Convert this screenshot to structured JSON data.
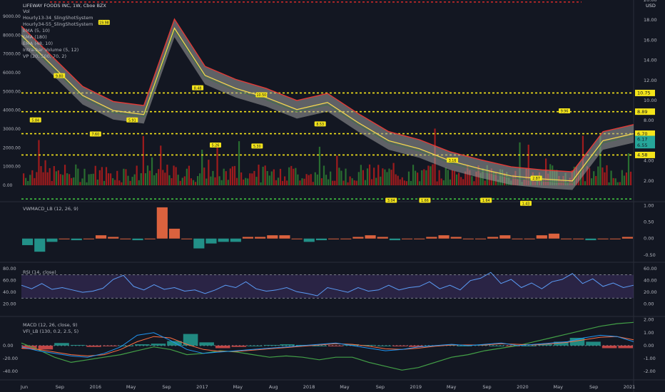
{
  "chart_data": {
    "type": "line",
    "title": "LIFEWAY FOODS INC, 1W, Cboe BZX",
    "currency": "USD",
    "indicators": [
      "Vol",
      "Hourly13-34_SlingShotSystem",
      "Hourly34-55_SlingShotSystem",
      "EMA (5, 10)",
      "SMA (180)",
      "EMA (48, 10)",
      "Intra-bar Volume (5, 12)",
      "VP (20, 500, 70, 2)"
    ],
    "x_ticks": [
      "Jun",
      "Sep",
      "2016",
      "May",
      "Sep",
      "2017",
      "May",
      "Aug",
      "2018",
      "May",
      "Sep",
      "2019",
      "May",
      "Sep",
      "2020",
      "May",
      "Sep",
      "2021"
    ],
    "main": {
      "price_axis": [
        "20.00",
        "18.00",
        "16.00",
        "14.00",
        "12.00",
        "10.00",
        "8.00",
        "6.00",
        "4.00",
        "2.00"
      ],
      "volume_axis": [
        "9000.00",
        "8000.00",
        "7000.00",
        "6000.00",
        "5000.00",
        "4000.00",
        "3000.00",
        "2000.00",
        "1000.00",
        "0.00"
      ],
      "ylim": [
        0,
        20
      ],
      "price_labels": [
        "10.75",
        "8.89",
        "6.70",
        "6.17",
        "6.55",
        "4.58"
      ],
      "levels": [
        {
          "value": 10.75,
          "color": "#f5e51a"
        },
        {
          "value": 8.89,
          "color": "#f5e51a"
        },
        {
          "value": 6.7,
          "color": "#f5e51a"
        },
        {
          "value": 4.58,
          "color": "#f5e51a"
        },
        {
          "value": 0.2,
          "color": "#3fbf3f"
        },
        {
          "value": 19.8,
          "color": "#c62828"
        }
      ],
      "price": {
        "x": [
          0,
          5,
          10,
          15,
          20,
          25,
          30,
          35,
          40,
          45,
          50,
          55,
          60,
          65,
          70,
          75,
          80,
          85,
          90,
          95,
          100
        ],
        "y": [
          16.5,
          13.5,
          10.5,
          9.0,
          8.6,
          17.2,
          12.5,
          11.2,
          10.3,
          9.1,
          9.8,
          7.8,
          6.0,
          5.2,
          4.0,
          3.2,
          2.5,
          2.2,
          2.0,
          6.0,
          6.7
        ]
      },
      "pivot_labels": [
        {
          "x": 13.5,
          "y": 17.7,
          "text": "19.98"
        },
        {
          "x": 6.2,
          "y": 12.4,
          "text": "9.80"
        },
        {
          "x": 28.8,
          "y": 11.2,
          "text": "8.48"
        },
        {
          "x": 39.2,
          "y": 10.5,
          "text": "10.50"
        },
        {
          "x": 48.8,
          "y": 7.6,
          "text": "8.53"
        },
        {
          "x": 70.4,
          "y": 4.0,
          "text": "3.16"
        },
        {
          "x": 88.7,
          "y": 8.9,
          "text": "9.96"
        },
        {
          "x": 2.3,
          "y": 8.0,
          "text": "5.84"
        },
        {
          "x": 18.1,
          "y": 8.0,
          "text": "5.91"
        },
        {
          "x": 12.1,
          "y": 6.6,
          "text": "7.60"
        },
        {
          "x": 31.7,
          "y": 5.5,
          "text": "5.26"
        },
        {
          "x": 38.5,
          "y": 5.4,
          "text": "5.30"
        },
        {
          "x": 60.4,
          "y": 0.0,
          "text": "3.04"
        },
        {
          "x": 65.9,
          "y": 0.0,
          "text": "1.66"
        },
        {
          "x": 75.9,
          "y": 0.0,
          "text": "1.64"
        },
        {
          "x": 82.4,
          "y": -0.3,
          "text": "1.43"
        },
        {
          "x": 84.1,
          "y": 2.2,
          "text": "2.87"
        }
      ]
    },
    "vwmacd": {
      "title": "VWMACD_LB (12, 26, 9)",
      "axis": [
        "1.00",
        "0.50",
        "0.00",
        "-0.50"
      ],
      "ylim": [
        -0.7,
        1.1
      ],
      "values": [
        -0.2,
        -0.4,
        -0.1,
        0.0,
        -0.05,
        0.0,
        0.1,
        0.05,
        0.0,
        -0.05,
        0.0,
        0.95,
        0.3,
        0.0,
        -0.3,
        -0.15,
        -0.1,
        -0.1,
        0.05,
        0.05,
        0.1,
        0.1,
        0.0,
        -0.1,
        -0.05,
        0.0,
        0.0,
        0.05,
        0.1,
        0.05,
        -0.05,
        0.0,
        0.0,
        0.05,
        0.1,
        0.05,
        0.0,
        0.0,
        0.05,
        0.1,
        0.0,
        0.0,
        0.1,
        0.15,
        0.0,
        0.0,
        -0.05,
        0.0,
        0.0,
        0.05
      ]
    },
    "rsi": {
      "title": "RSI (14, close)",
      "axis_left": [
        "80.00",
        "60.00",
        "40.00",
        "20.00"
      ],
      "axis_right": [
        "60.00",
        "40.00",
        "20.00",
        "0.00"
      ],
      "ylim": [
        0,
        90
      ],
      "band": [
        70,
        30
      ],
      "values": [
        52,
        46,
        55,
        45,
        48,
        44,
        40,
        42,
        47,
        62,
        69,
        50,
        44,
        53,
        45,
        48,
        42,
        44,
        38,
        44,
        52,
        48,
        58,
        46,
        42,
        44,
        48,
        41,
        38,
        34,
        48,
        44,
        40,
        48,
        42,
        44,
        52,
        44,
        48,
        50,
        58,
        46,
        52,
        44,
        60,
        64,
        74,
        55,
        62,
        48,
        56,
        46,
        58,
        62,
        72,
        55,
        63,
        50,
        56,
        48,
        52
      ]
    },
    "macd": {
      "title": "MACD (12, 26, close, 9)",
      "subtitle": "VFI_LB (130, 0.2, 2.5, 5)",
      "axis_left": [
        "0.00",
        "-20.00",
        "-40.00"
      ],
      "axis_right": [
        "2.00",
        "1.00",
        "0.00",
        "-1.00",
        "-2.00"
      ],
      "ylim": [
        -2.6,
        2.2
      ],
      "macd_line": [
        -0.1,
        -0.4,
        -0.6,
        -0.8,
        -0.9,
        -0.6,
        -0.1,
        0.8,
        1.0,
        0.4,
        -0.3,
        -0.6,
        -0.5,
        -0.4,
        -0.3,
        -0.2,
        -0.1,
        0.0,
        0.1,
        0.2,
        0.0,
        -0.2,
        -0.4,
        -0.3,
        -0.1,
        0.0,
        0.1,
        0.0,
        0.1,
        0.2,
        0.0,
        0.1,
        0.2,
        0.3,
        0.6,
        0.8,
        0.7,
        0.3
      ],
      "signal_line": [
        -0.2,
        -0.3,
        -0.5,
        -0.7,
        -0.8,
        -0.7,
        -0.3,
        0.3,
        0.7,
        0.6,
        0.1,
        -0.3,
        -0.45,
        -0.45,
        -0.35,
        -0.25,
        -0.15,
        -0.05,
        0.05,
        0.15,
        0.1,
        -0.05,
        -0.25,
        -0.3,
        -0.2,
        -0.05,
        0.05,
        0.05,
        0.05,
        0.15,
        0.1,
        0.05,
        0.15,
        0.25,
        0.45,
        0.65,
        0.7,
        0.45
      ],
      "vfi_line": [
        0.2,
        -0.3,
        -0.9,
        -1.3,
        -1.1,
        -0.9,
        -0.7,
        -0.4,
        -0.1,
        -0.3,
        -0.7,
        -0.6,
        -0.4,
        -0.5,
        -0.7,
        -0.9,
        -0.8,
        -0.9,
        -1.1,
        -0.9,
        -0.9,
        -1.3,
        -1.6,
        -1.9,
        -1.7,
        -1.3,
        -0.9,
        -0.7,
        -0.4,
        -0.2,
        0.0,
        0.3,
        0.6,
        0.9,
        1.2,
        1.5,
        1.7,
        1.8
      ],
      "histogram": [
        -0.25,
        -0.3,
        0.2,
        0.05,
        -0.1,
        -0.05,
        0.0,
        0.1,
        0.15,
        0.35,
        0.9,
        0.25,
        -0.2,
        -0.1,
        0.0,
        0.05,
        0.1,
        0.05,
        0.0,
        -0.05,
        0.1,
        0.05,
        0.0,
        -0.05,
        -0.1,
        0.0,
        0.05,
        0.0,
        0.05,
        0.0,
        -0.05,
        0.0,
        0.1,
        0.3,
        0.6,
        0.3,
        -0.2,
        -0.2
      ]
    }
  }
}
